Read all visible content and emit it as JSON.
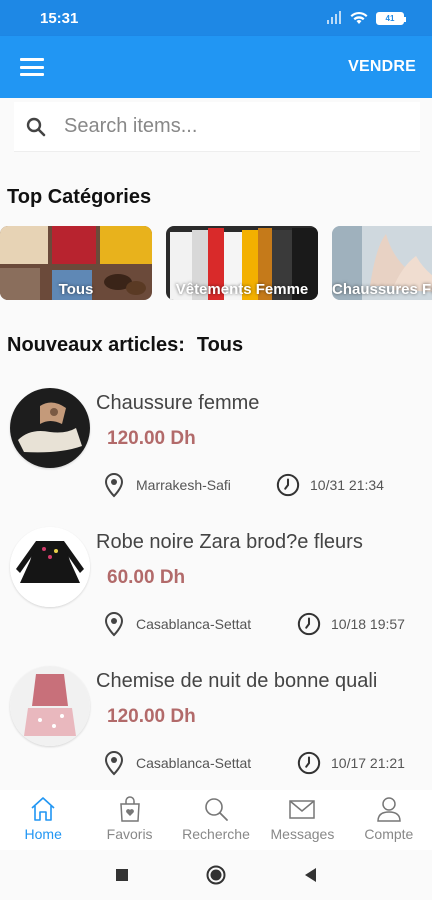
{
  "status": {
    "time": "15:31",
    "battery": "41"
  },
  "app_bar": {
    "sell_label": "VENDRE"
  },
  "search": {
    "placeholder": "Search items..."
  },
  "top_categories": {
    "title": "Top Catégories",
    "items": [
      {
        "label": "Tous"
      },
      {
        "label": "Vêtements Femme"
      },
      {
        "label": "Chaussures Femme"
      }
    ]
  },
  "new_items": {
    "title": "Nouveaux articles:",
    "filter": "Tous",
    "items": [
      {
        "title": "Chaussure femme",
        "price": "120.00 Dh",
        "location": "Marrakesh-Safi",
        "date": "10/31 21:34"
      },
      {
        "title": "Robe noire Zara brod?e fleurs",
        "price": "60.00 Dh",
        "location": "Casablanca-Settat",
        "date": "10/18 19:57"
      },
      {
        "title": "Chemise de nuit de bonne quali",
        "price": "120.00 Dh",
        "location": "Casablanca-Settat",
        "date": "10/17 21:21"
      }
    ]
  },
  "bottom_nav": {
    "items": [
      {
        "label": "Home",
        "icon": "home-icon",
        "active": true
      },
      {
        "label": "Favoris",
        "icon": "favorites-bag-icon"
      },
      {
        "label": "Recherche",
        "icon": "search-icon"
      },
      {
        "label": "Messages",
        "icon": "mail-icon"
      },
      {
        "label": "Compte",
        "icon": "account-icon"
      }
    ]
  },
  "colors": {
    "primary": "#2196f3",
    "status_bar": "#1e88e5",
    "price": "#b26a6a"
  }
}
